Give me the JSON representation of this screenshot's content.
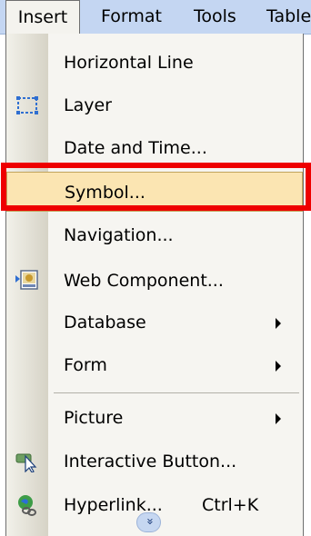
{
  "menubar": {
    "items": [
      {
        "label": "Insert",
        "active": true
      },
      {
        "label": "Format",
        "active": false
      },
      {
        "label": "Tools",
        "active": false
      },
      {
        "label": "Table",
        "active": false
      }
    ]
  },
  "insert_menu": {
    "items": [
      {
        "label": "Horizontal Line",
        "icon": null,
        "has_submenu": false
      },
      {
        "label": "Layer",
        "icon": "layer-icon",
        "has_submenu": false
      },
      {
        "label": "Date and Time...",
        "icon": null,
        "has_submenu": false
      },
      {
        "label": "Symbol...",
        "icon": null,
        "has_submenu": false,
        "highlighted": true
      },
      {
        "label": "Navigation...",
        "icon": null,
        "has_submenu": false
      },
      {
        "label": "Web Component...",
        "icon": "web-component-icon",
        "has_submenu": false
      },
      {
        "label": "Database",
        "icon": null,
        "has_submenu": true
      },
      {
        "label": "Form",
        "icon": null,
        "has_submenu": true
      },
      {
        "label": "Picture",
        "icon": null,
        "has_submenu": true
      },
      {
        "label": "Interactive Button...",
        "icon": "interactive-button-icon",
        "has_submenu": false
      },
      {
        "label": "Hyperlink...",
        "icon": "hyperlink-icon",
        "has_submenu": false,
        "shortcut": "Ctrl+K"
      }
    ],
    "expand_glyph": "»",
    "expand_icon": "chevron-double-down-icon"
  },
  "colors": {
    "menubar_bg": "#c4d6f2",
    "menu_bg": "#f6f5f1",
    "highlight_bg": "#fbe5b2",
    "annotation": "#ee0000"
  }
}
